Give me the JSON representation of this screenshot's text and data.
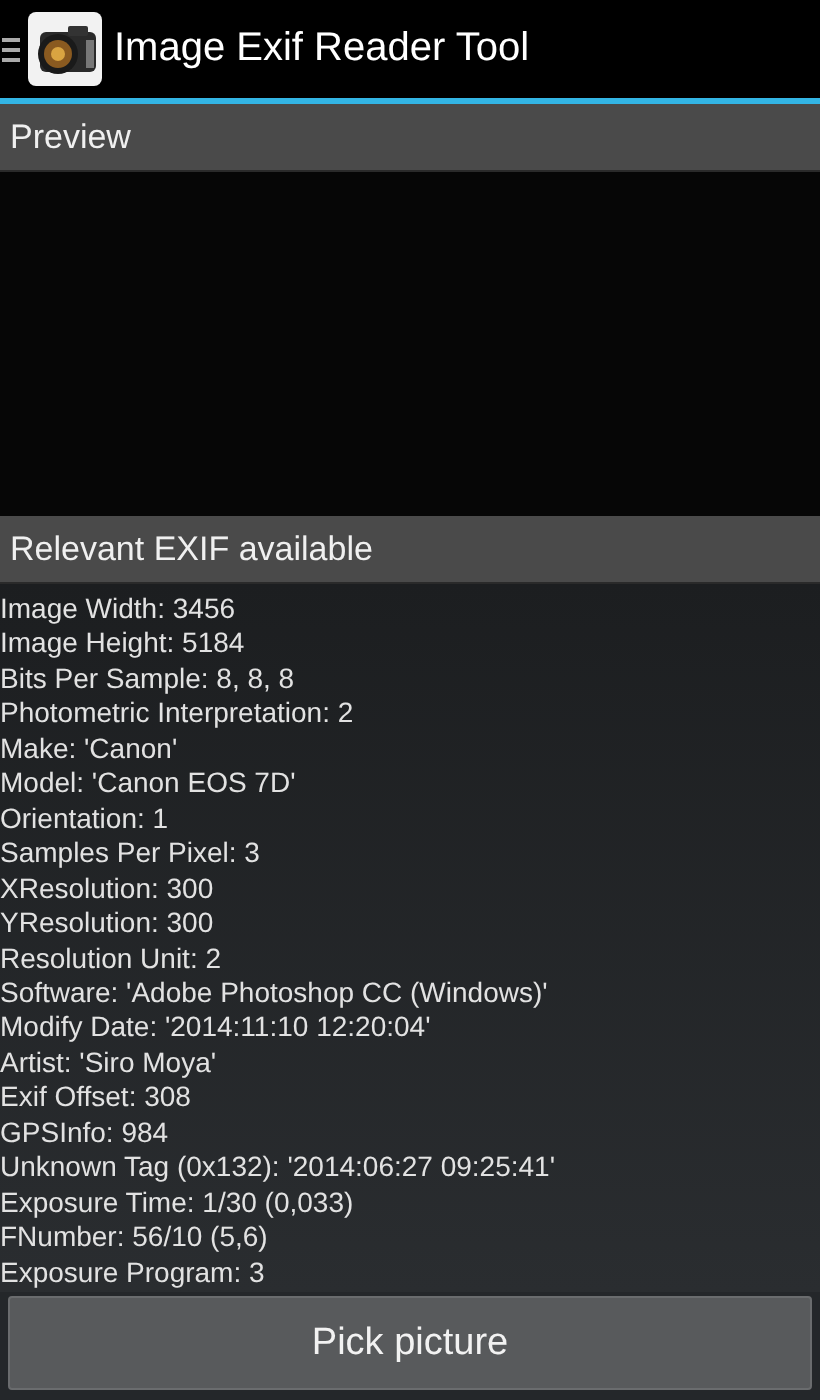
{
  "action_bar": {
    "title": "Image Exif Reader Tool"
  },
  "preview": {
    "header": "Preview"
  },
  "exif": {
    "header": "Relevant EXIF available",
    "lines": [
      "Image Width: 3456",
      "Image Height: 5184",
      "Bits Per Sample: 8, 8, 8",
      "Photometric Interpretation: 2",
      "Make: 'Canon'",
      "Model: 'Canon EOS 7D'",
      "Orientation: 1",
      "Samples Per Pixel: 3",
      "XResolution: 300",
      "YResolution: 300",
      "Resolution Unit: 2",
      "Software: 'Adobe Photoshop CC (Windows)'",
      "Modify Date: '2014:11:10 12:20:04'",
      "Artist: 'Siro Moya'",
      "Exif Offset: 308",
      "GPSInfo: 984",
      "Unknown Tag (0x132): '2014:06:27 09:25:41'",
      "Exposure Time: 1/30 (0,033)",
      "FNumber: 56/10 (5,6)",
      "Exposure Program: 3"
    ]
  },
  "button": {
    "label": "Pick picture"
  }
}
